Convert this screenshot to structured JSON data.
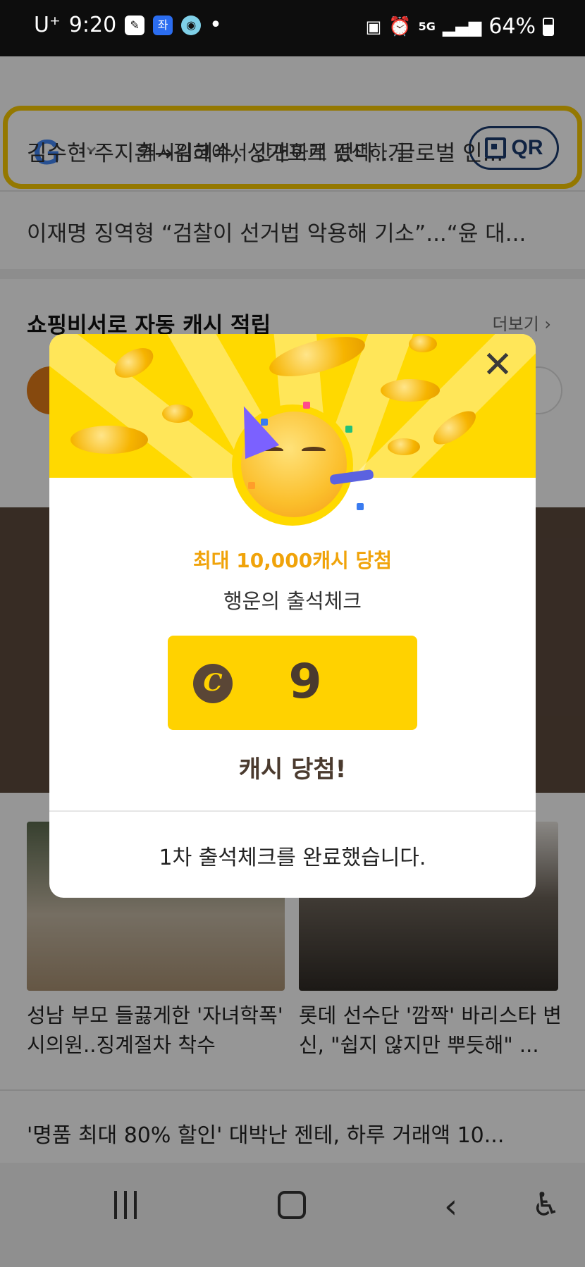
{
  "status_bar": {
    "carrier": "U⁺",
    "time": "9:20",
    "dot": "•",
    "battery": "64%",
    "network": "5G"
  },
  "search": {
    "placeholder": "캐시워크에서 간편하게 검색하기",
    "qr_label": "QR",
    "google_letter": "G"
  },
  "news": {
    "line1": "김수현·주지훈→김혜수, 싱가포르 떴다...글로벌 인...",
    "line2": "이재명 징역형 “검찰이 선거법 악용해 기소”...“윤 대..."
  },
  "shopping": {
    "title": "쇼핑비서로 자동 캐시 적립",
    "more": "더보기 ›"
  },
  "articles": [
    {
      "caption": "성남 부모 들끓게한 '자녀학폭' 시의원..징계절차 착수"
    },
    {
      "caption": "롯데 선수단 '깜짝' 바리스타 변신, \"쉽지 않지만 뿌듯해\" ..."
    }
  ],
  "bottom_news": "'명품 최대 80% 할인' 대박난 젠테, 하루 거래액 10...",
  "modal": {
    "close": "✕",
    "headline": "최대 10,000캐시 당첨",
    "subtitle": "행운의 출석체크",
    "coin_symbol": "C",
    "amount": "9",
    "win": "캐시 당첨!",
    "footer": "1차 출석체크를 완료했습니다."
  },
  "navbar": {
    "back": "‹",
    "accessibility": "♿︎"
  }
}
